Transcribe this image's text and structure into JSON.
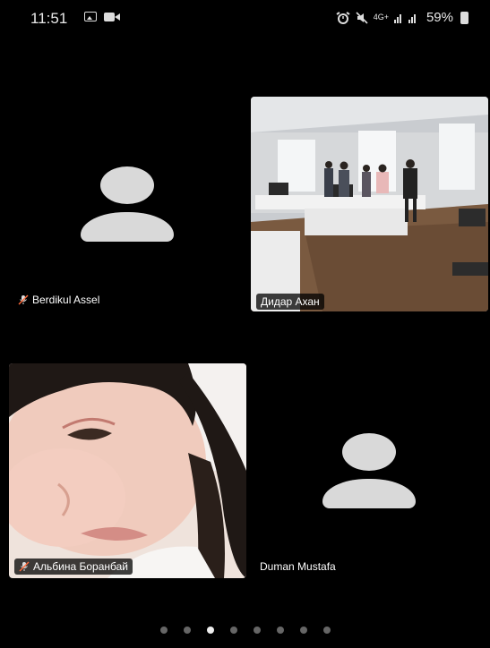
{
  "status_bar": {
    "time": "11:51",
    "network_label": "4G+",
    "battery_percent": "59%",
    "icons": [
      "image-icon",
      "video-camera-icon",
      "alarm-icon",
      "mute-icon",
      "signal-icon",
      "battery-icon"
    ]
  },
  "participants": [
    {
      "name": "Berdikul Assel",
      "muted": true,
      "video": false
    },
    {
      "name": "Дидар Ахан",
      "muted": false,
      "video": true
    },
    {
      "name": "Альбина Боранбай",
      "muted": true,
      "video": true
    },
    {
      "name": "Duman Mustafa",
      "muted": false,
      "video": false
    }
  ],
  "pager": {
    "count": 8,
    "active_index": 2
  },
  "colors": {
    "background": "#000000",
    "avatar": "#d9d9d9",
    "active_dot": "#eeeeee",
    "inactive_dot": "#666666"
  }
}
